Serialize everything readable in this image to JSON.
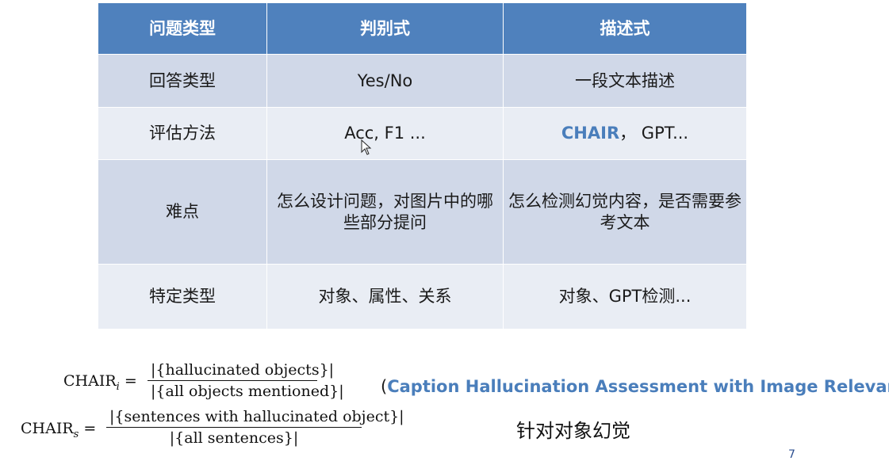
{
  "table": {
    "header": [
      "问题类型",
      "判别式",
      "描述式"
    ],
    "rows": [
      {
        "label": "回答类型",
        "discriminative": "Yes/No",
        "descriptive": "一段文本描述"
      },
      {
        "label": "评估方法",
        "discriminative": "Acc, F1 ...",
        "descriptive_accent": "CHAIR",
        "descriptive_rest": "， GPT..."
      },
      {
        "label": "难点",
        "discriminative": "怎么设计问题，对图片中的哪些部分提问",
        "descriptive": "怎么检测幻觉内容，是否需要参考文本"
      },
      {
        "label": "特定类型",
        "discriminative": "对象、属性、关系",
        "descriptive": "对象、GPT检测..."
      }
    ]
  },
  "formulas": {
    "chair_i": {
      "lhs": "CHAIR",
      "sub": "i",
      "numerator": "|{hallucinated objects}|",
      "denominator": "|{all objects mentioned}|"
    },
    "chair_s": {
      "lhs": "CHAIR",
      "sub": "s",
      "numerator": "|{sentences with hallucinated object}|",
      "denominator": "|{all sentences}|"
    }
  },
  "caption": {
    "open": "(",
    "text": "Caption Hallucination Assessment with Image Relevance",
    "close": ")"
  },
  "note": "针对对象幻觉",
  "page_number": "7",
  "colors": {
    "header": "#4f81bd",
    "row_odd": "#d0d8e8",
    "row_even": "#e9edf4",
    "accent": "#4a7ebb"
  }
}
